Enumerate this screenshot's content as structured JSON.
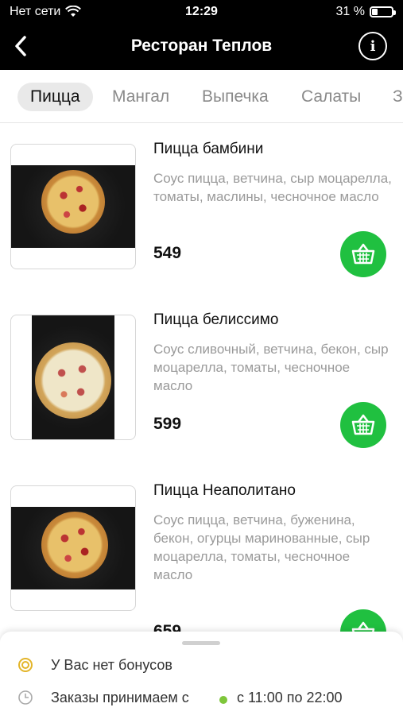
{
  "status_bar": {
    "carrier": "Нет сети",
    "time": "12:29",
    "battery_percent": "31 %",
    "battery_level": 0.31
  },
  "header": {
    "title": "Ресторан Теплов",
    "back_icon": "chevron-left-icon",
    "info_icon": "info-icon"
  },
  "categories": [
    {
      "label": "Пицца",
      "active": true
    },
    {
      "label": "Мангал",
      "active": false
    },
    {
      "label": "Выпечка",
      "active": false
    },
    {
      "label": "Салаты",
      "active": false
    },
    {
      "label": "З",
      "active": false
    }
  ],
  "items": [
    {
      "name": "Пицца бамбини",
      "description": "Соус пицца, ветчина, сыр моцарелла, томаты, маслины, чесночное масло",
      "price": "549"
    },
    {
      "name": "Пицца белиссимо",
      "description": "Соус сливочный, ветчина, бекон, сыр моцарелла, томаты, чесночное масло",
      "price": "599"
    },
    {
      "name": "Пицца Неаполитано",
      "description": "Соус пицца, ветчина, буженина, бекон, огурцы маринованные, сыр моцарелла, томаты, чесночное масло",
      "price": "659"
    }
  ],
  "bottom_sheet": {
    "bonus_text": "У Вас нет бонусов",
    "orders_text": "Заказы принимаем с",
    "hours_text": "с 11:00 по 22:00"
  },
  "colors": {
    "accent_green": "#20c040",
    "status_dot": "#7ec63a",
    "header_bg": "#000000"
  }
}
